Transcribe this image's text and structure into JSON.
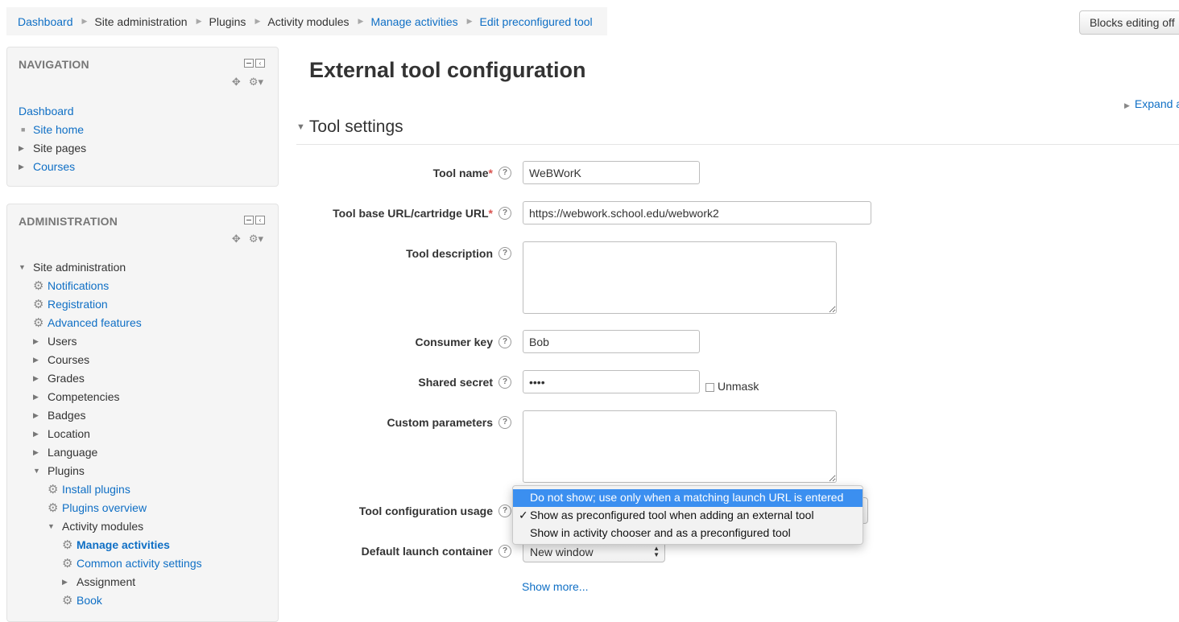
{
  "breadcrumb": {
    "dashboard": "Dashboard",
    "site_admin": "Site administration",
    "plugins": "Plugins",
    "activity_modules": "Activity modules",
    "manage_activities": "Manage activities",
    "edit_tool": "Edit preconfigured tool"
  },
  "header": {
    "blocks_button": "Blocks editing off"
  },
  "navigation": {
    "title": "NAVIGATION",
    "dashboard": "Dashboard",
    "site_home": "Site home",
    "site_pages": "Site pages",
    "courses": "Courses"
  },
  "administration": {
    "title": "ADMINISTRATION",
    "site_administration": "Site administration",
    "notifications": "Notifications",
    "registration": "Registration",
    "advanced_features": "Advanced features",
    "users": "Users",
    "courses": "Courses",
    "grades": "Grades",
    "competencies": "Competencies",
    "badges": "Badges",
    "location": "Location",
    "language": "Language",
    "plugins": "Plugins",
    "install_plugins": "Install plugins",
    "plugins_overview": "Plugins overview",
    "activity_modules": "Activity modules",
    "manage_activities": "Manage activities",
    "common_activity_settings": "Common activity settings",
    "assignment": "Assignment",
    "book": "Book"
  },
  "main": {
    "title": "External tool configuration",
    "expand_all": "Expand a",
    "section": "Tool settings",
    "show_more": "Show more..."
  },
  "form": {
    "tool_name_label": "Tool name",
    "tool_name_value": "WeBWorK",
    "base_url_label": "Tool base URL/cartridge URL",
    "base_url_value": "https://webwork.school.edu/webwork2",
    "description_label": "Tool description",
    "consumer_key_label": "Consumer key",
    "consumer_key_value": "Bob",
    "shared_secret_label": "Shared secret",
    "shared_secret_value": "••••",
    "unmask_label": "Unmask",
    "custom_params_label": "Custom parameters",
    "usage_label": "Tool configuration usage",
    "usage_options": [
      "Do not show; use only when a matching launch URL is entered",
      "Show as preconfigured tool when adding an external tool",
      "Show in activity chooser and as a preconfigured tool"
    ],
    "usage_checkmark": "✓",
    "launch_container_label": "Default launch container",
    "launch_container_value": "New window",
    "required_marker": "*",
    "help_glyph": "?"
  },
  "colors": {
    "link": "#0f6fc5",
    "required": "#d9534f",
    "highlight": "#3b8ff0",
    "block_bg": "#f5f5f5"
  }
}
